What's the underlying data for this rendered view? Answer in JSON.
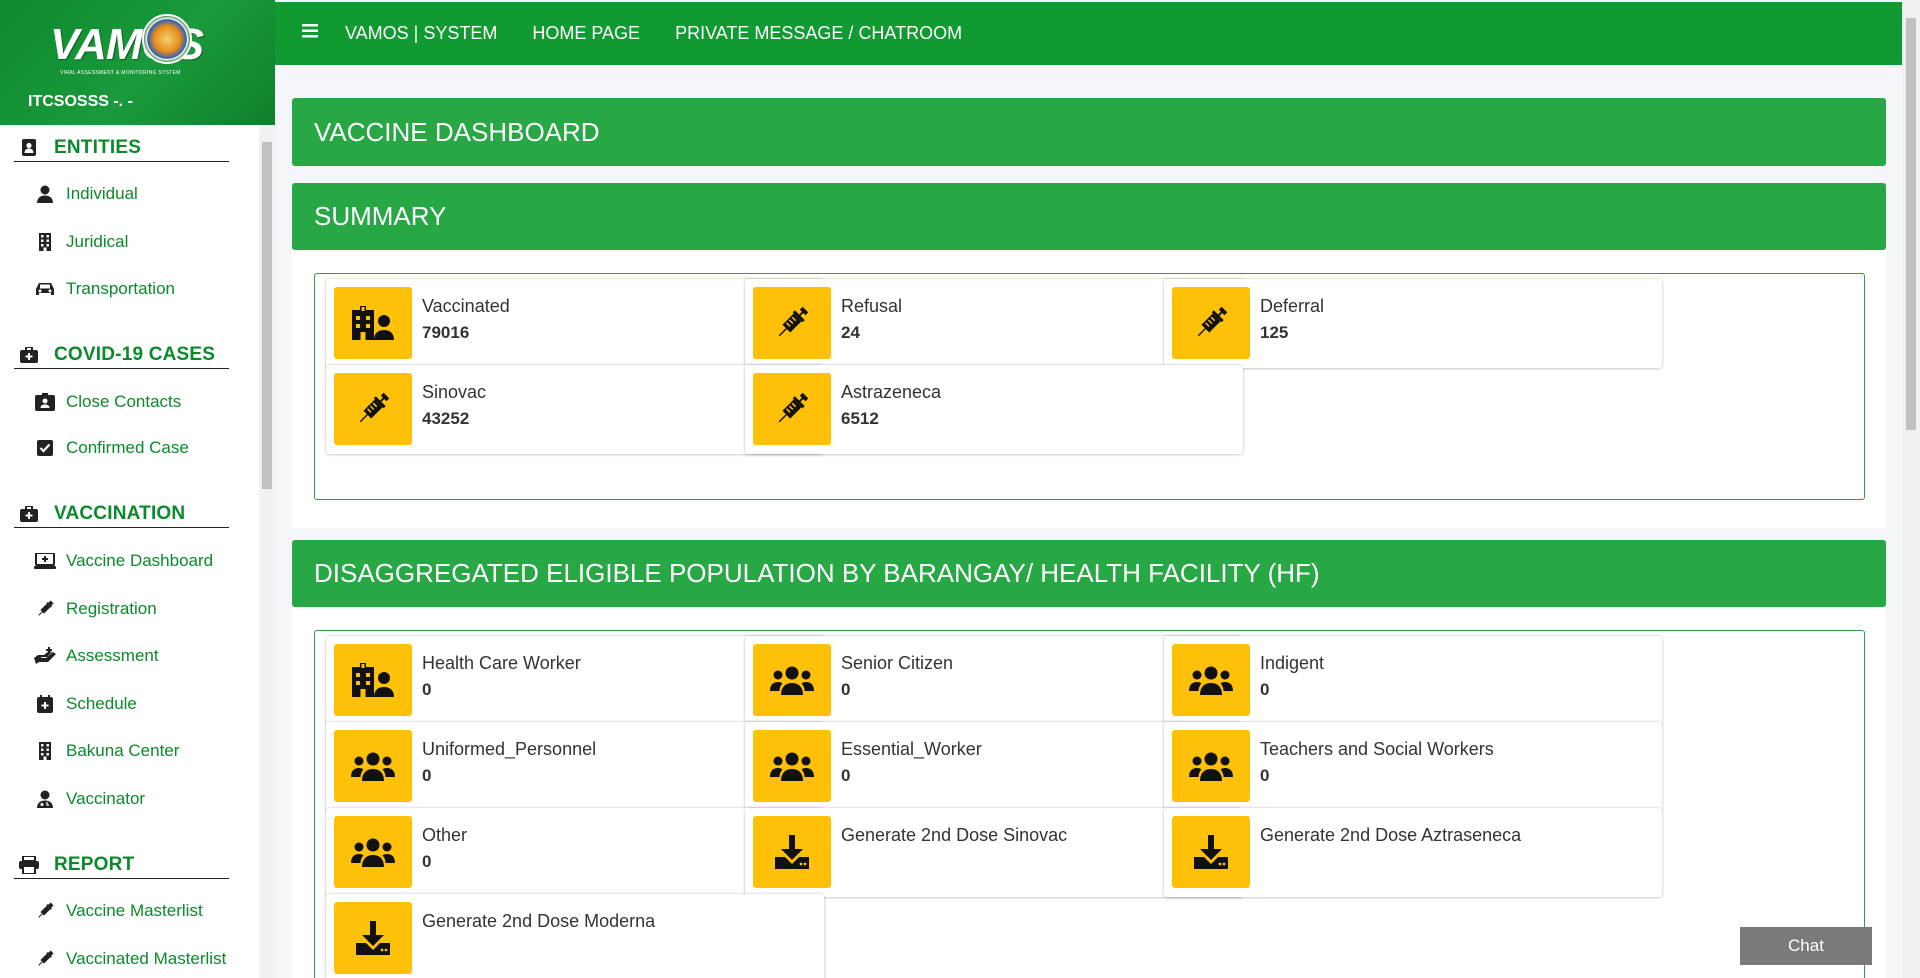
{
  "brand": {
    "logo_text": "VAMOS",
    "tagline": "VIRAL ASSESSMENT & MONITORING SYSTEM",
    "user": "ITCSOSSS -. -"
  },
  "topnav": {
    "links": [
      "VAMOS | SYSTEM",
      "HOME PAGE",
      "PRIVATE MESSAGE / CHATROOM"
    ]
  },
  "sidebar": {
    "sections": [
      {
        "title": "ENTITIES",
        "icon": "address-card-icon",
        "items": [
          {
            "label": "Individual",
            "icon": "user-icon"
          },
          {
            "label": "Juridical",
            "icon": "building-icon"
          },
          {
            "label": "Transportation",
            "icon": "car-icon"
          }
        ]
      },
      {
        "title": "COVID-19 CASES",
        "icon": "medkit-icon",
        "items": [
          {
            "label": "Close Contacts",
            "icon": "id-badge-icon"
          },
          {
            "label": "Confirmed Case",
            "icon": "check-square-icon"
          }
        ]
      },
      {
        "title": "VACCINATION",
        "icon": "medkit-icon",
        "items": [
          {
            "label": "Vaccine Dashboard",
            "icon": "laptop-medical-icon"
          },
          {
            "label": "Registration",
            "icon": "syringe-icon"
          },
          {
            "label": "Assessment",
            "icon": "hand-holding-medical-icon"
          },
          {
            "label": "Schedule",
            "icon": "calendar-plus-icon"
          },
          {
            "label": "Bakuna Center",
            "icon": "building-icon"
          },
          {
            "label": "Vaccinator",
            "icon": "user-md-icon"
          }
        ]
      },
      {
        "title": "REPORT",
        "icon": "print-icon",
        "items": [
          {
            "label": "Vaccine Masterlist",
            "icon": "syringe-icon"
          },
          {
            "label": "Vaccinated Masterlist",
            "icon": "syringe-icon"
          }
        ]
      }
    ]
  },
  "main": {
    "dashboard_title": "VACCINE DASHBOARD",
    "summary_title": "SUMMARY",
    "summary_cards": [
      {
        "label": "Vaccinated",
        "value": "79016",
        "icon": "hospital-user-icon"
      },
      {
        "label": "Refusal",
        "value": "24",
        "icon": "syringe-icon"
      },
      {
        "label": "Deferral",
        "value": "125",
        "icon": "syringe-icon"
      },
      {
        "label": "Sinovac",
        "value": "43252",
        "icon": "syringe-icon"
      },
      {
        "label": "Astrazeneca",
        "value": "6512",
        "icon": "syringe-icon"
      }
    ],
    "population_title": "DISAGGREGATED ELIGIBLE POPULATION BY BARANGAY/ HEALTH FACILITY (HF)",
    "population_cards": [
      {
        "label": "Health Care Worker",
        "value": "0",
        "icon": "hospital-user-icon"
      },
      {
        "label": "Senior Citizen",
        "value": "0",
        "icon": "users-icon"
      },
      {
        "label": "Indigent",
        "value": "0",
        "icon": "users-icon"
      },
      {
        "label": "Uniformed_Personnel",
        "value": "0",
        "icon": "users-icon"
      },
      {
        "label": "Essential_Worker",
        "value": "0",
        "icon": "users-icon"
      },
      {
        "label": "Teachers and Social Workers",
        "value": "0",
        "icon": "users-icon"
      },
      {
        "label": "Other",
        "value": "0",
        "icon": "users-icon"
      },
      {
        "label": "Generate 2nd Dose Sinovac",
        "value": "",
        "icon": "download-icon"
      },
      {
        "label": "Generate 2nd Dose Aztraseneca",
        "value": "",
        "icon": "download-icon"
      },
      {
        "label": "Generate 2nd Dose Moderna",
        "value": "",
        "icon": "download-icon"
      }
    ]
  },
  "chat": {
    "label": "Chat"
  },
  "colors": {
    "brand_green": "#119a31",
    "banner_green": "#28a745",
    "icon_yellow": "#ffc107",
    "nav_text_green": "#0a8a2a"
  }
}
